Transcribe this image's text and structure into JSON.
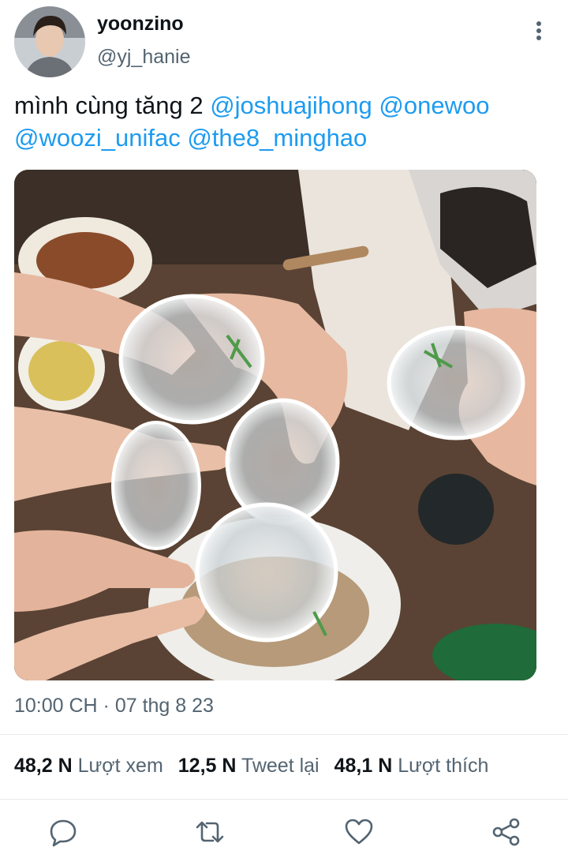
{
  "author": {
    "display_name": "yoonzino",
    "handle": "@yj_hanie"
  },
  "tweet": {
    "text_prefix": "mình cùng tăng 2",
    "mentions": [
      "@joshuajihong",
      "@onewoo",
      "@woozi_unifac",
      "@the8_minghao"
    ],
    "timestamp": "10:00 CH · 07 thg 8 23"
  },
  "stats": [
    {
      "value": "48,2 N",
      "label": "Lượt xem"
    },
    {
      "value": "12,5 N",
      "label": "Tweet lại"
    },
    {
      "value": "48,1 N",
      "label": "Lượt thích"
    }
  ],
  "actions": {
    "reply": "reply-icon",
    "retweet": "retweet-icon",
    "like": "heart-icon",
    "share": "share-icon"
  },
  "colors": {
    "link": "#1d9bf0",
    "secondary_text": "#536471",
    "primary_text": "#0f1419"
  }
}
